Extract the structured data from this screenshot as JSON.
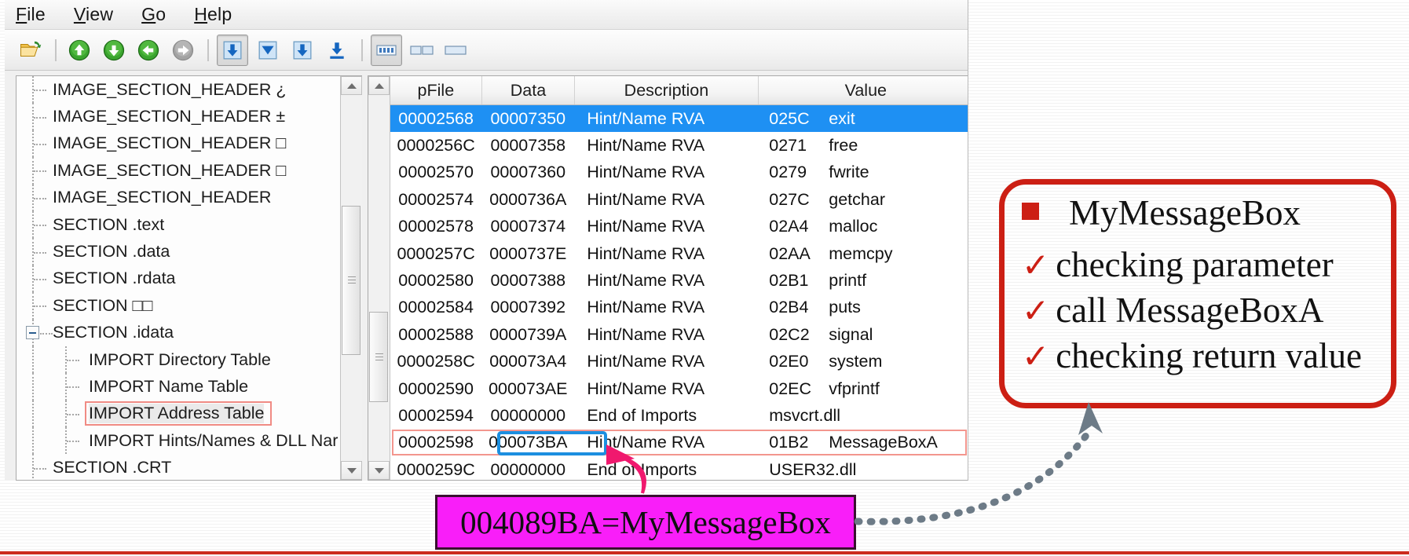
{
  "window": {
    "menu": [
      {
        "label": "File",
        "accel": "F"
      },
      {
        "label": "View",
        "accel": "V"
      },
      {
        "label": "Go",
        "accel": "G"
      },
      {
        "label": "Help",
        "accel": "H"
      }
    ],
    "toolbar": [
      {
        "name": "open-file-icon",
        "glyph": "folder"
      },
      {
        "name": "nav-up-icon",
        "glyph": "arrow-up-green"
      },
      {
        "name": "nav-down-icon",
        "glyph": "arrow-down-green"
      },
      {
        "name": "nav-back-icon",
        "glyph": "arrow-left-green"
      },
      {
        "name": "nav-forward-icon",
        "glyph": "arrow-right-gray"
      },
      {
        "name": "goto-offset-icon",
        "glyph": "box-arrow-down-blue"
      },
      {
        "name": "collapse-icon",
        "glyph": "box-triangle-down-blue"
      },
      {
        "name": "goto-section-icon",
        "glyph": "box-arrow-down-blue2"
      },
      {
        "name": "goto-end-icon",
        "glyph": "arrow-down-bar-blue"
      },
      {
        "name": "view-detail-icon",
        "glyph": "bars-view"
      },
      {
        "name": "view-split-icon",
        "glyph": "two-pane-view"
      },
      {
        "name": "view-single-icon",
        "glyph": "single-pane-view"
      }
    ]
  },
  "tree": {
    "items": [
      {
        "label": "IMAGE_SECTION_HEADER ¿",
        "level": 1,
        "selected": false,
        "expander": false
      },
      {
        "label": "IMAGE_SECTION_HEADER ±",
        "level": 1,
        "selected": false,
        "expander": false
      },
      {
        "label": "IMAGE_SECTION_HEADER □",
        "level": 1,
        "selected": false,
        "expander": false
      },
      {
        "label": "IMAGE_SECTION_HEADER □",
        "level": 1,
        "selected": false,
        "expander": false
      },
      {
        "label": "IMAGE_SECTION_HEADER",
        "level": 1,
        "selected": false,
        "expander": false
      },
      {
        "label": "SECTION .text",
        "level": 1,
        "selected": false,
        "expander": false
      },
      {
        "label": "SECTION .data",
        "level": 1,
        "selected": false,
        "expander": false
      },
      {
        "label": "SECTION .rdata",
        "level": 1,
        "selected": false,
        "expander": false
      },
      {
        "label": "SECTION □□",
        "level": 1,
        "selected": false,
        "expander": false
      },
      {
        "label": "SECTION .idata",
        "level": 1,
        "selected": false,
        "expander": true
      },
      {
        "label": "IMPORT Directory Table",
        "level": 2,
        "selected": false,
        "expander": false
      },
      {
        "label": "IMPORT Name Table",
        "level": 2,
        "selected": false,
        "expander": false
      },
      {
        "label": "IMPORT Address Table",
        "level": 2,
        "selected": true,
        "expander": false
      },
      {
        "label": "IMPORT Hints/Names & DLL Nar",
        "level": 2,
        "selected": false,
        "expander": false
      },
      {
        "label": "SECTION .CRT",
        "level": 1,
        "selected": false,
        "expander": false
      }
    ]
  },
  "list": {
    "columns": [
      "pFile",
      "Data",
      "Description",
      "Value"
    ],
    "rows": [
      {
        "pFile": "00002568",
        "data": "00007350",
        "desc": "Hint/Name RVA",
        "hint": "025C",
        "value": "exit",
        "selected": true,
        "outlined": false
      },
      {
        "pFile": "0000256C",
        "data": "00007358",
        "desc": "Hint/Name RVA",
        "hint": "0271",
        "value": "free",
        "selected": false,
        "outlined": false
      },
      {
        "pFile": "00002570",
        "data": "00007360",
        "desc": "Hint/Name RVA",
        "hint": "0279",
        "value": "fwrite",
        "selected": false,
        "outlined": false
      },
      {
        "pFile": "00002574",
        "data": "0000736A",
        "desc": "Hint/Name RVA",
        "hint": "027C",
        "value": "getchar",
        "selected": false,
        "outlined": false
      },
      {
        "pFile": "00002578",
        "data": "00007374",
        "desc": "Hint/Name RVA",
        "hint": "02A4",
        "value": "malloc",
        "selected": false,
        "outlined": false
      },
      {
        "pFile": "0000257C",
        "data": "0000737E",
        "desc": "Hint/Name RVA",
        "hint": "02AA",
        "value": "memcpy",
        "selected": false,
        "outlined": false
      },
      {
        "pFile": "00002580",
        "data": "00007388",
        "desc": "Hint/Name RVA",
        "hint": "02B1",
        "value": "printf",
        "selected": false,
        "outlined": false
      },
      {
        "pFile": "00002584",
        "data": "00007392",
        "desc": "Hint/Name RVA",
        "hint": "02B4",
        "value": "puts",
        "selected": false,
        "outlined": false
      },
      {
        "pFile": "00002588",
        "data": "0000739A",
        "desc": "Hint/Name RVA",
        "hint": "02C2",
        "value": "signal",
        "selected": false,
        "outlined": false
      },
      {
        "pFile": "0000258C",
        "data": "000073A4",
        "desc": "Hint/Name RVA",
        "hint": "02E0",
        "value": "system",
        "selected": false,
        "outlined": false
      },
      {
        "pFile": "00002590",
        "data": "000073AE",
        "desc": "Hint/Name RVA",
        "hint": "02EC",
        "value": "vfprintf",
        "selected": false,
        "outlined": false
      },
      {
        "pFile": "00002594",
        "data": "00000000",
        "desc": "End of Imports",
        "hint": "",
        "value": "msvcrt.dll",
        "selected": false,
        "outlined": false,
        "dll_only": true
      },
      {
        "pFile": "00002598",
        "data": "000073BA",
        "desc": "Hint/Name RVA",
        "hint": "01B2",
        "value": "MessageBoxA",
        "selected": false,
        "outlined": true,
        "data_boxed": true
      },
      {
        "pFile": "0000259C",
        "data": "00000000",
        "desc": "End of Imports",
        "hint": "",
        "value": "USER32.dll",
        "selected": false,
        "outlined": false,
        "dll_only": true
      }
    ]
  },
  "callout": {
    "title": "MyMessageBox",
    "bullets": [
      "checking parameter",
      "call MessageBoxA",
      "checking return value"
    ],
    "check_glyph": "✓",
    "border_color": "#cc1f14"
  },
  "magenta_note": {
    "text": "004089BA=MyMessageBox",
    "fill_color": "#f91ef9"
  },
  "annotations": {
    "pink_arrow_name": "pink-arrow-to-data-cell",
    "dotted_arrow_name": "dotted-arrow-to-callout"
  }
}
